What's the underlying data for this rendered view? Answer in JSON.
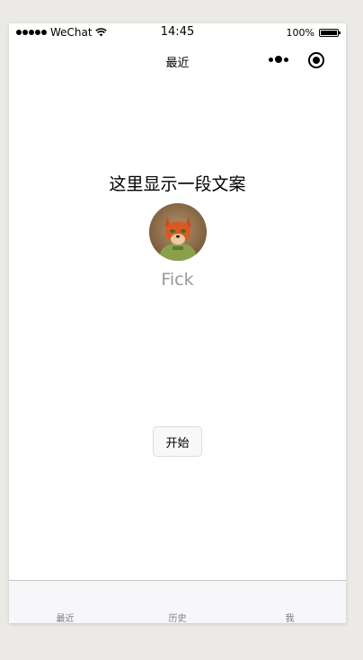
{
  "status_bar": {
    "carrier": "WeChat",
    "time": "14:45",
    "battery": "100%"
  },
  "nav": {
    "title": "最近",
    "more_icon": "more-dots-icon",
    "close_icon": "target-icon"
  },
  "main": {
    "motto": "这里显示一段文案",
    "username": "Fick",
    "avatar_icon": "fox-avatar",
    "start_label": "开始"
  },
  "tabbar": {
    "items": [
      {
        "label": "最近"
      },
      {
        "label": "历史"
      },
      {
        "label": "我"
      }
    ]
  },
  "colors": {
    "page_background": "#ebeae6",
    "tab_text": "#7a7e83",
    "username_text": "#999999"
  }
}
